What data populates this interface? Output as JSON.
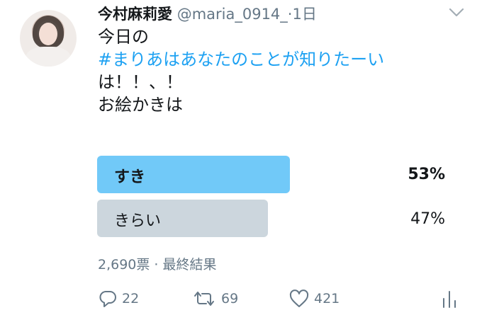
{
  "tweet": {
    "author_name": "今村麻莉愛",
    "author_handle": "@maria_0914_",
    "separator": "·",
    "time": "1日",
    "lines": [
      "今日の",
      "#まりあはあなたのことが知りたーい",
      "は！！、！",
      "お絵かきは"
    ]
  },
  "poll": {
    "options": [
      {
        "label": "すき",
        "percent": "53%",
        "share": 0.53,
        "winner": true
      },
      {
        "label": "きらい",
        "percent": "47%",
        "share": 0.47,
        "winner": false
      }
    ],
    "meta": "2,690票 · 最終結果"
  },
  "actions": {
    "reply_count": "22",
    "retweet_count": "69",
    "like_count": "421"
  },
  "colors": {
    "accent": "#1da1f2",
    "poll_winner": "#71c9f8",
    "poll_other": "#ccd6dd",
    "muted": "#657786"
  },
  "icons": [
    "chevron-down-icon",
    "reply-icon",
    "retweet-icon",
    "like-icon",
    "analytics-icon"
  ]
}
